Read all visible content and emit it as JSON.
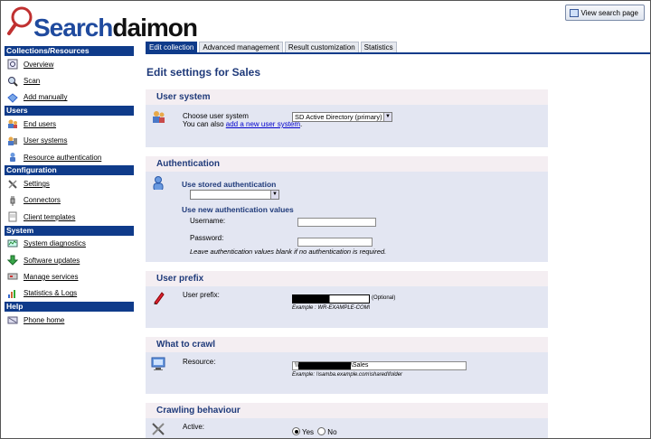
{
  "header": {
    "logo_left": "Search",
    "logo_right": "daimon",
    "view_search_label": "View search page"
  },
  "sidebar": {
    "sections": [
      {
        "title": "Collections/Resources",
        "items": [
          {
            "label": "Overview",
            "icon": "overview-icon"
          },
          {
            "label": "Scan",
            "icon": "magnifier-icon"
          },
          {
            "label": "Add manually",
            "icon": "diamond-icon"
          }
        ]
      },
      {
        "title": "Users",
        "items": [
          {
            "label": "End users",
            "icon": "users-icon"
          },
          {
            "label": "User systems",
            "icon": "user-systems-icon"
          },
          {
            "label": "Resource authentication",
            "icon": "person-icon"
          }
        ]
      },
      {
        "title": "Configuration",
        "items": [
          {
            "label": "Settings",
            "icon": "wrench-icon"
          },
          {
            "label": "Connectors",
            "icon": "plug-icon"
          },
          {
            "label": "Client templates",
            "icon": "template-icon"
          }
        ]
      },
      {
        "title": "System",
        "items": [
          {
            "label": "System diagnostics",
            "icon": "diagnostics-icon"
          },
          {
            "label": "Software updates",
            "icon": "download-arrow-icon"
          },
          {
            "label": "Manage services",
            "icon": "services-icon"
          },
          {
            "label": "Statistics & Logs",
            "icon": "statistics-icon"
          }
        ]
      },
      {
        "title": "Help",
        "items": [
          {
            "label": "Phone home",
            "icon": "phone-home-icon"
          }
        ]
      }
    ]
  },
  "tabs": [
    "Edit collection",
    "Advanced management",
    "Result customization",
    "Statistics"
  ],
  "page_title": "Edit settings for Sales",
  "user_system": {
    "heading": "User system",
    "label": "Choose user system",
    "selected": "SD Active Directory (primary)",
    "also_text": "You can also",
    "link_text": "add a new user system",
    "after_link": "."
  },
  "authentication": {
    "heading": "Authentication",
    "stored_label": "Use stored authentication",
    "new_label": "Use new authentication values",
    "username_label": "Username:",
    "password_label": "Password:",
    "note": "Leave authentication values blank if no authentication is required."
  },
  "user_prefix": {
    "heading": "User prefix",
    "label": "User prefix:",
    "optional": "(Optional)",
    "example": "Example : WR-EXAMPLE-COM\\"
  },
  "what_to_crawl": {
    "heading": "What to crawl",
    "label": "Resource:",
    "value_prefix": "\\\\",
    "value_suffix": "\\Sales",
    "example": "Example: \\\\samba.example.com\\shared\\folder"
  },
  "crawling_behaviour": {
    "heading": "Crawling behaviour",
    "active_label": "Active:",
    "yes": "Yes",
    "no": "No",
    "active_value": "Yes"
  }
}
